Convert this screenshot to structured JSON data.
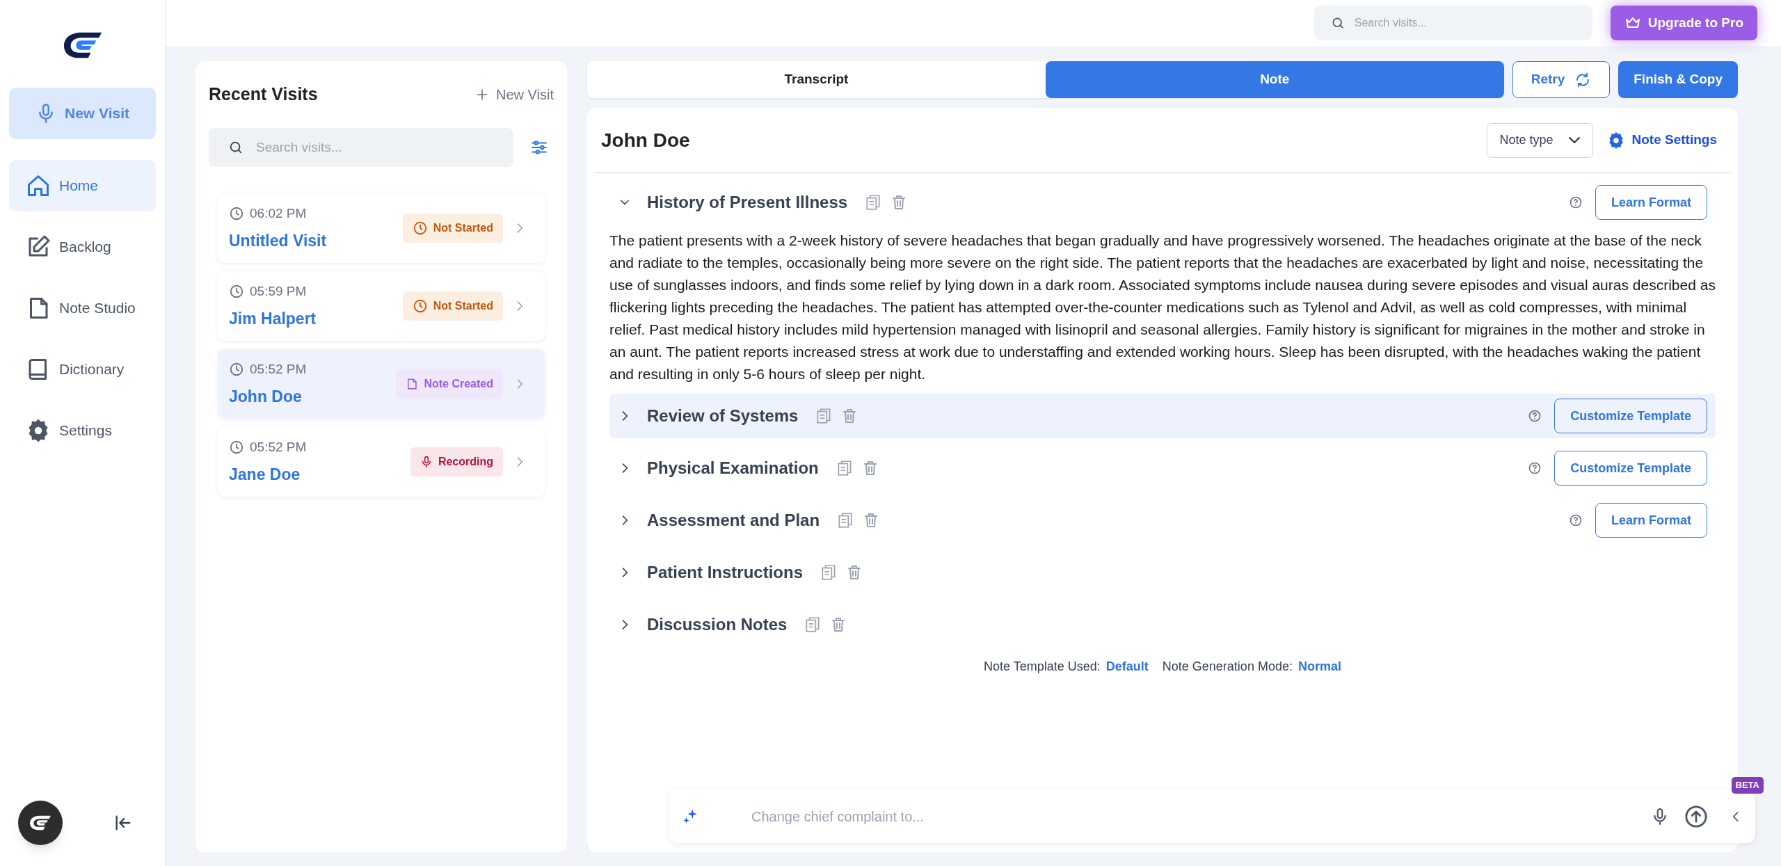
{
  "sidebar": {
    "new_visit": {
      "label": "New Visit",
      "disabled": true
    },
    "items": [
      {
        "label": "Home",
        "kind": "home",
        "selected": true
      },
      {
        "label": "Backlog",
        "kind": "edit",
        "selected": false
      },
      {
        "label": "Note Studio",
        "kind": "file",
        "selected": false
      },
      {
        "label": "Dictionary",
        "kind": "book",
        "selected": false
      },
      {
        "label": "Settings",
        "kind": "gear",
        "selected": false
      }
    ]
  },
  "header": {
    "search": {
      "placeholder": "Search visits..."
    },
    "upgrade_button": "Upgrade to Pro"
  },
  "recent_visits": {
    "title": "Recent Visits",
    "new_visit": "New Visit",
    "search": {
      "placeholder": "Search visits..."
    },
    "visits": [
      {
        "time": "06:02 PM",
        "name": "Untitled Visit",
        "status": "Not Started",
        "kind": "pending",
        "selected": false
      },
      {
        "time": "05:59 PM",
        "name": "Jim Halpert",
        "status": "Not Started",
        "kind": "pending",
        "selected": false
      },
      {
        "time": "05:52 PM",
        "name": "John Doe",
        "status": "Note Created",
        "kind": "note",
        "selected": true
      },
      {
        "time": "05:52 PM",
        "name": "Jane Doe",
        "status": "Recording",
        "kind": "recording",
        "selected": false
      }
    ]
  },
  "tabs": [
    {
      "label": "Transcript",
      "selected": false
    },
    {
      "label": "Note",
      "selected": true
    }
  ],
  "actions": {
    "retry": "Retry",
    "finish": "Finish & Copy"
  },
  "note": {
    "patient": "John Doe",
    "note_type": "Note type",
    "settings": "Note Settings",
    "sections": [
      {
        "title": "History of Present Illness",
        "expanded": true,
        "highlighted": false,
        "button": "Learn Format",
        "body": "The patient presents with a 2-week history of severe headaches that began gradually and have progressively worsened. The headaches originate at the base of the neck and radiate to the temples, occasionally being more severe on the right side. The patient reports that the headaches are exacerbated by light and noise, necessitating the use of sunglasses indoors, and finds some relief by lying down in a dark room. Associated symptoms include nausea during severe episodes and visual auras described as flickering lights preceding the headaches. The patient has attempted over-the-counter medications such as Tylenol and Advil, as well as cold compresses, with minimal relief. Past medical history includes mild hypertension managed with lisinopril and seasonal allergies. Family history is significant for migraines in the mother and stroke in an aunt. The patient reports increased stress at work due to understaffing and extended working hours. Sleep has been disrupted, with the headaches waking the patient and resulting in only 5-6 hours of sleep per night."
      },
      {
        "title": "Review of Systems",
        "expanded": false,
        "highlighted": true,
        "button": "Customize Template"
      },
      {
        "title": "Physical Examination",
        "expanded": false,
        "highlighted": false,
        "button": "Customize Template"
      },
      {
        "title": "Assessment and Plan",
        "expanded": false,
        "highlighted": false,
        "button": "Learn Format"
      },
      {
        "title": "Patient Instructions",
        "expanded": false,
        "highlighted": false
      },
      {
        "title": "Discussion Notes",
        "expanded": false,
        "highlighted": false
      }
    ],
    "footer": {
      "template_label": "Note Template Used:",
      "template": "Default",
      "mode_label": "Note Generation Mode:",
      "mode": "Normal"
    }
  },
  "chat": {
    "placeholder": "Change chief complaint to...",
    "badge": "BETA"
  }
}
